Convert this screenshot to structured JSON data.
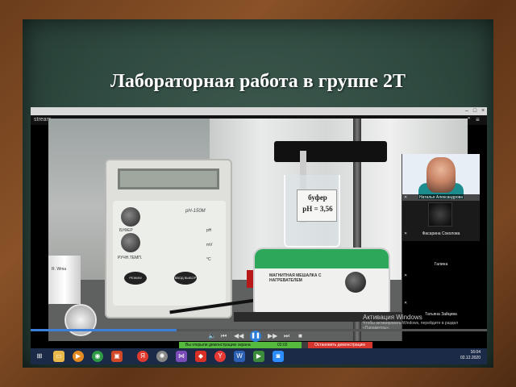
{
  "board": {
    "title": "Лабораторная работа  в группе 2Т"
  },
  "window": {
    "controls": [
      "–",
      "□",
      "×"
    ]
  },
  "app": {
    "name": "stream"
  },
  "video": {
    "beaker_label_line1": "буфер",
    "beaker_label_line2": "pH = 3,56",
    "stirrer_text": "МАГНИТНАЯ МЕШАЛКА С НАГРЕВАТЕЛЕМ",
    "meter_model": "pH-150M",
    "meter_labels": [
      "БУФЕР",
      "РУЧН.ТЕМП.",
      "pH",
      "mV",
      "°C"
    ],
    "meter_buttons": [
      "РЕЖИМ",
      "ВВОД ВЫБОР"
    ],
    "progress": 0.32
  },
  "participants": [
    {
      "name": "Наталья Александрова"
    },
    {
      "name": "Фасарина Соколова"
    },
    {
      "name": "Галина"
    },
    {
      "name": "Татьяна Зайцева"
    }
  ],
  "watermark": {
    "title": "Активация Windows",
    "subtitle": "Чтобы активировать Windows, перейдите в раздел «Параметры»."
  },
  "notification": {
    "sharing_text": "Вы открыли демонстрацию экрана",
    "time": "02:02",
    "stop_text": "Остановить демонстрацию"
  },
  "taskbar": {
    "icons": [
      "windows-logo",
      "file-explorer",
      "media-player",
      "chrome",
      "office",
      "yandex",
      "media",
      "visual-studio",
      "adobe",
      "yandex-browser",
      "word",
      "video-app",
      "zoom"
    ],
    "time": "16:04",
    "date": "02.12.2020"
  },
  "colors": {
    "board": "#2f4a40",
    "frame": "#6b3d1c",
    "taskbar": "#1b2a46",
    "notif_green": "#55b93e",
    "notif_red": "#d7362f",
    "accent": "#2f7fd8"
  }
}
